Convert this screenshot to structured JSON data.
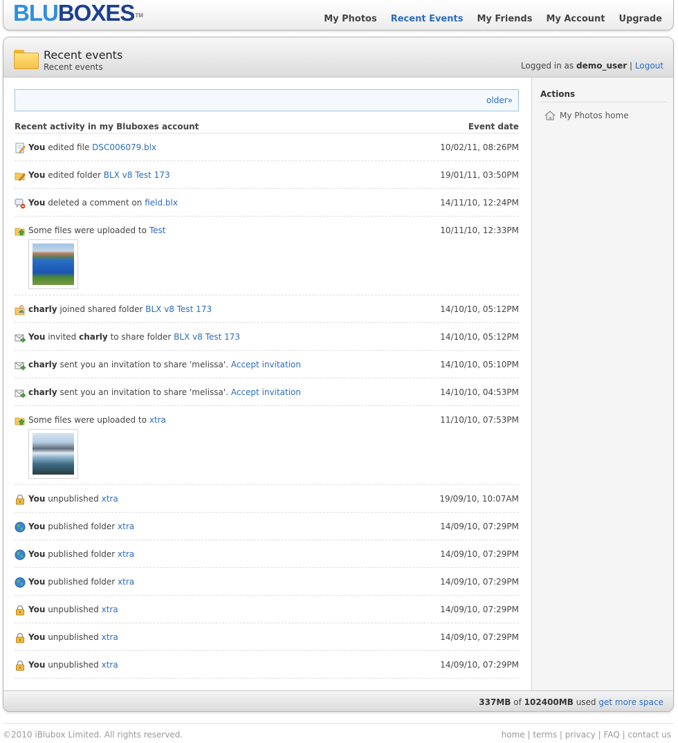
{
  "brand": {
    "part1": "BLU",
    "part2": "BOXES",
    "tm": "TM"
  },
  "nav": [
    {
      "label": "My Photos",
      "active": false
    },
    {
      "label": "Recent Events",
      "active": true
    },
    {
      "label": "My Friends",
      "active": false
    },
    {
      "label": "My Account",
      "active": false
    },
    {
      "label": "Upgrade",
      "active": false
    }
  ],
  "header": {
    "title": "Recent events",
    "subtitle": "Recent events",
    "login_prefix": "Logged in as",
    "username": "demo_user",
    "separator": "|",
    "logout": "Logout"
  },
  "pager": {
    "older": "older»"
  },
  "list": {
    "col_activity": "Recent activity in my Bluboxes account",
    "col_date": "Event date"
  },
  "events": [
    {
      "icon": "edit-file",
      "actor": "You",
      "text": "edited file",
      "link": "DSC006079.blx",
      "date": "10/02/11, 08:26PM"
    },
    {
      "icon": "edit-folder",
      "actor": "You",
      "text": "edited folder",
      "link": "BLX v8 Test 173",
      "date": "19/01/11, 03:50PM"
    },
    {
      "icon": "delete-comment",
      "actor": "You",
      "text": "deleted a comment on",
      "link": "field.blx",
      "date": "14/11/10, 12:24PM"
    },
    {
      "icon": "upload-folder",
      "actor": "",
      "text": "Some files were uploaded to",
      "link": "Test",
      "date": "10/11/10, 12:33PM",
      "thumb": "pool"
    },
    {
      "icon": "user-folder",
      "actor": "charly",
      "text": "joined shared folder",
      "link": "BLX v8 Test 173",
      "date": "14/10/10, 05:12PM"
    },
    {
      "icon": "invite",
      "actor": "You",
      "text": "invited",
      "actor2": "charly",
      "text2": "to share folder",
      "link": "BLX v8 Test 173",
      "date": "14/10/10, 05:12PM"
    },
    {
      "icon": "invite",
      "actor": "charly",
      "text": "sent you an invitation to share 'melissa'.",
      "link": "Accept invitation",
      "date": "14/10/10, 05:10PM"
    },
    {
      "icon": "invite",
      "actor": "charly",
      "text": "sent you an invitation to share 'melissa'.",
      "link": "Accept invitation",
      "date": "14/10/10, 04:53PM"
    },
    {
      "icon": "upload-folder",
      "actor": "",
      "text": "Some files were uploaded to",
      "link": "xtra",
      "date": "11/10/10, 07:53PM",
      "thumb": "falls"
    },
    {
      "icon": "lock",
      "actor": "You",
      "text": "unpublished",
      "link": "xtra",
      "date": "19/09/10, 10:07AM"
    },
    {
      "icon": "globe",
      "actor": "You",
      "text": "published folder",
      "link": "xtra",
      "date": "14/09/10, 07:29PM"
    },
    {
      "icon": "globe",
      "actor": "You",
      "text": "published folder",
      "link": "xtra",
      "date": "14/09/10, 07:29PM"
    },
    {
      "icon": "globe",
      "actor": "You",
      "text": "published folder",
      "link": "xtra",
      "date": "14/09/10, 07:29PM"
    },
    {
      "icon": "lock",
      "actor": "You",
      "text": "unpublished",
      "link": "xtra",
      "date": "14/09/10, 07:29PM"
    },
    {
      "icon": "lock",
      "actor": "You",
      "text": "unpublished",
      "link": "xtra",
      "date": "14/09/10, 07:29PM"
    },
    {
      "icon": "lock",
      "actor": "You",
      "text": "unpublished",
      "link": "xtra",
      "date": "14/09/10, 07:29PM"
    }
  ],
  "sidebar": {
    "title": "Actions",
    "home": "My Photos home"
  },
  "usage": {
    "used": "337MB",
    "of": "of",
    "total": "102400MB",
    "used_label": "used",
    "more": "get more space"
  },
  "footer": {
    "copyright": "©2010 iBlubox Limited. All rights reserved.",
    "links": [
      "home",
      "terms",
      "privacy",
      "FAQ",
      "contact us"
    ]
  }
}
